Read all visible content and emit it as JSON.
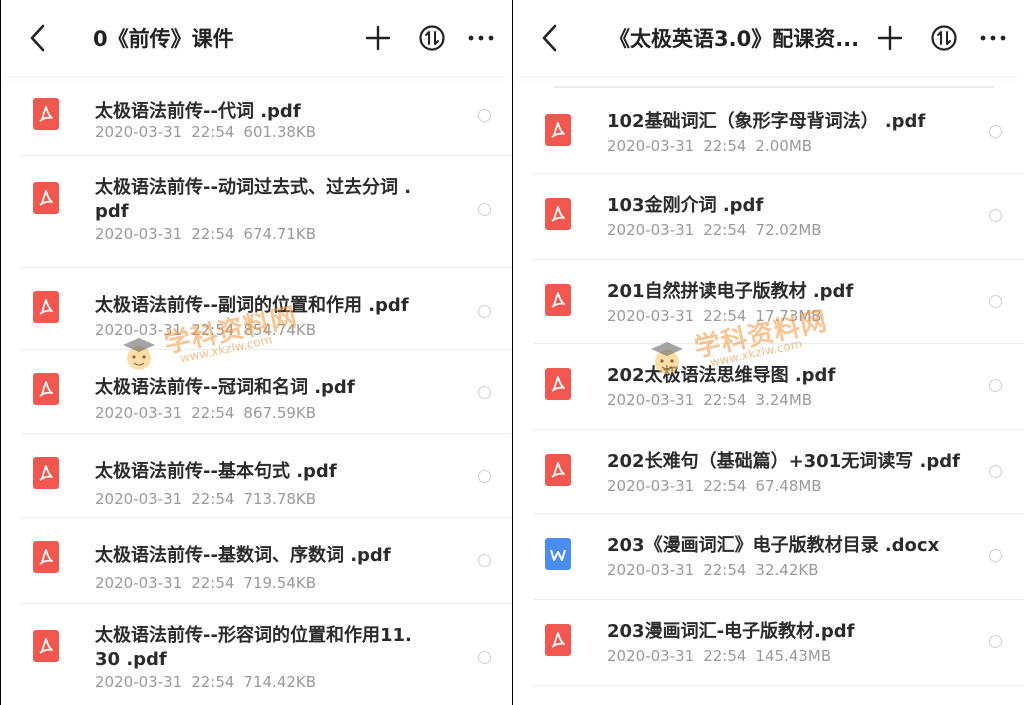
{
  "left_panel": {
    "title": "0《前传》课件",
    "items": [
      {
        "name": "太极语法前传--代词 .pdf",
        "date": "2020-03-31",
        "time": "22:54",
        "size": "601.38KB",
        "type": "pdf"
      },
      {
        "name": "太极语法前传--动词过去式、过去分词 .pdf",
        "date": "2020-03-31",
        "time": "22:54",
        "size": "674.71KB",
        "type": "pdf"
      },
      {
        "name": "太极语法前传--副词的位置和作用 .pdf",
        "date": "2020-03-31",
        "time": "22:54",
        "size": "854.74KB",
        "type": "pdf"
      },
      {
        "name": "太极语法前传--冠词和名词 .pdf",
        "date": "2020-03-31",
        "time": "22:54",
        "size": "867.59KB",
        "type": "pdf"
      },
      {
        "name": "太极语法前传--基本句式 .pdf",
        "date": "2020-03-31",
        "time": "22:54",
        "size": "713.78KB",
        "type": "pdf"
      },
      {
        "name": "太极语法前传--基数词、序数词 .pdf",
        "date": "2020-03-31",
        "time": "22:54",
        "size": "719.54KB",
        "type": "pdf"
      },
      {
        "name": "太极语法前传--形容词的位置和作用11.30 .pdf",
        "date": "2020-03-31",
        "time": "22:54",
        "size": "714.42KB",
        "type": "pdf"
      }
    ]
  },
  "right_panel": {
    "title": "《太极英语3.0》配课资...",
    "items": [
      {
        "name": "102基础词汇（象形字母背词法） .pdf",
        "date": "2020-03-31",
        "time": "22:54",
        "size": "2.00MB",
        "type": "pdf"
      },
      {
        "name": "103金刚介词 .pdf",
        "date": "2020-03-31",
        "time": "22:54",
        "size": "72.02MB",
        "type": "pdf"
      },
      {
        "name": "201自然拼读电子版教材 .pdf",
        "date": "2020-03-31",
        "time": "22:54",
        "size": "17.73MB",
        "type": "pdf"
      },
      {
        "name": "202太极语法思维导图 .pdf",
        "date": "2020-03-31",
        "time": "22:54",
        "size": "3.24MB",
        "type": "pdf"
      },
      {
        "name": "202长难句（基础篇）+301无词读写 .pdf",
        "date": "2020-03-31",
        "time": "22:54",
        "size": "67.48MB",
        "type": "pdf"
      },
      {
        "name": "203《漫画词汇》电子版教材目录 .docx",
        "date": "2020-03-31",
        "time": "22:54",
        "size": "32.42KB",
        "type": "docx"
      },
      {
        "name": "203漫画词汇-电子版教材.pdf",
        "date": "2020-03-31",
        "time": "22:54",
        "size": "145.43MB",
        "type": "pdf"
      }
    ]
  },
  "watermark": {
    "text": "学科资料网",
    "url": "www.xkzlw.com"
  },
  "icons": {
    "back": "chevron-left-icon",
    "add": "plus-icon",
    "sort": "sort-icon",
    "more": "more-horizontal-icon",
    "pdf": "pdf-file-icon",
    "docx": "word-file-icon"
  },
  "colors": {
    "pdf": "#f2574f",
    "docx": "#4a8cf0",
    "meta": "#9a9a9a",
    "title": "#222222"
  }
}
